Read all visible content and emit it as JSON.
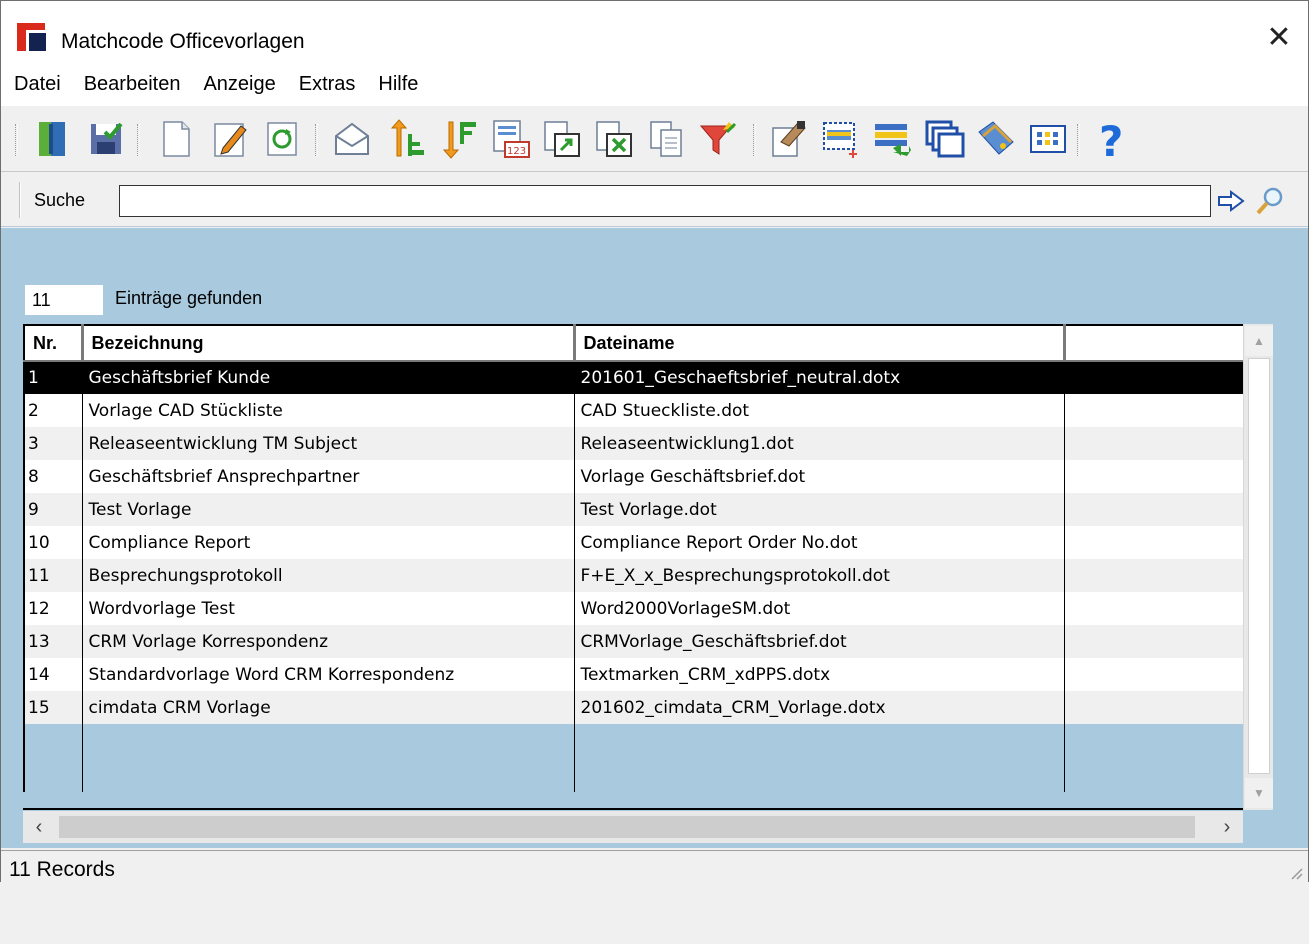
{
  "window": {
    "title": "Matchcode Officevorlagen",
    "close_glyph": "✕"
  },
  "menu": [
    "Datei",
    "Bearbeiten",
    "Anzeige",
    "Extras",
    "Hilfe"
  ],
  "toolbar": {
    "buttons": [
      "exit-door-icon",
      "save-icon",
      "new-document-icon",
      "edit-document-icon",
      "refresh-icon",
      "email-icon",
      "sort-ascending-icon",
      "sort-descending-icon",
      "report-123-icon",
      "export-icon",
      "excel-export-icon",
      "copy-icon",
      "filter-icon",
      "properties-icon",
      "new-selection-icon",
      "transfer-icon",
      "windows-icon",
      "tag-icon",
      "columns-icon",
      "help-icon"
    ]
  },
  "search": {
    "label": "Suche",
    "value": ""
  },
  "results": {
    "count": "11",
    "label": "Einträge gefunden"
  },
  "grid": {
    "columns": [
      "Nr.",
      "Bezeichnung",
      "Dateiname",
      ""
    ],
    "rows": [
      {
        "nr": "1",
        "name": "Geschäftsbrief Kunde",
        "file": "201601_Geschaeftsbrief_neutral.dotx"
      },
      {
        "nr": "2",
        "name": "Vorlage CAD Stückliste",
        "file": "CAD Stueckliste.dot"
      },
      {
        "nr": "3",
        "name": "Releaseentwicklung TM Subject",
        "file": "Releaseentwicklung1.dot"
      },
      {
        "nr": "8",
        "name": "Geschäftsbrief Ansprechpartner",
        "file": "Vorlage Geschäftsbrief.dot"
      },
      {
        "nr": "9",
        "name": "Test Vorlage",
        "file": "Test Vorlage.dot"
      },
      {
        "nr": "10",
        "name": "Compliance Report",
        "file": "Compliance Report Order No.dot"
      },
      {
        "nr": "11",
        "name": "Besprechungsprotokoll",
        "file": "F+E_X_x_Besprechungsprotokoll.dot"
      },
      {
        "nr": "12",
        "name": "Wordvorlage Test",
        "file": "Word2000VorlageSM.dot"
      },
      {
        "nr": "13",
        "name": "CRM Vorlage Korrespondenz",
        "file": "CRMVorlage_Geschäftsbrief.dot"
      },
      {
        "nr": "14",
        "name": "Standardvorlage Word CRM Korrespondenz",
        "file": "Textmarken_CRM_xdPPS.dotx"
      },
      {
        "nr": "15",
        "name": "cimdata CRM Vorlage",
        "file": "201602_cimdata_CRM_Vorlage.dotx"
      }
    ],
    "selected_row": 0
  },
  "status": {
    "text": "11 Records"
  },
  "colors": {
    "grid_background": "#a9c9de",
    "selection": "#000000",
    "brand_red": "#d92a1c",
    "brand_navy": "#14224f"
  }
}
